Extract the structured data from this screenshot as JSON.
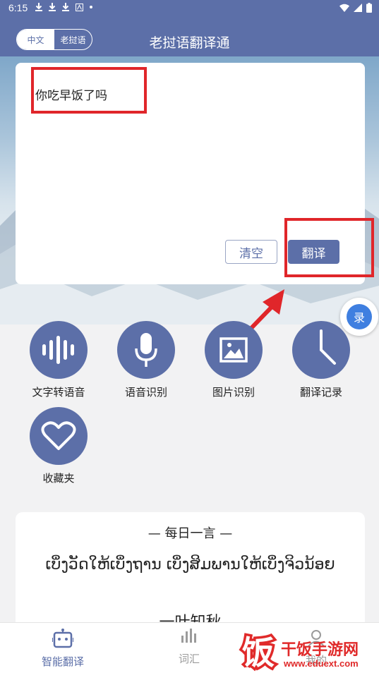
{
  "status_bar": {
    "time": "6:15"
  },
  "header": {
    "title": "老挝语翻译通",
    "lang_options": [
      "中文",
      "老挝语"
    ],
    "selected_lang": "中文"
  },
  "input": {
    "text": "你吃早饭了吗",
    "clear_label": "清空",
    "translate_label": "翻译"
  },
  "floating_badge": {
    "glyph": "录"
  },
  "features": [
    {
      "label": "文字转语音",
      "icon": "soundwave-icon"
    },
    {
      "label": "语音识别",
      "icon": "microphone-icon"
    },
    {
      "label": "图片识别",
      "icon": "image-icon"
    },
    {
      "label": "翻译记录",
      "icon": "clock-icon"
    },
    {
      "label": "收藏夹",
      "icon": "heart-icon"
    }
  ],
  "daily_quote": {
    "heading": "—  每日一言  —",
    "lao": "ເບິ່ງວັດໃຫ້ເບິ່ງຖານ ເບິ່ງສິມພານໃຫ້ເບິ່ງຈິວນ້ອຍ",
    "chinese": "一叶知秋"
  },
  "bottom_nav": [
    {
      "label": "智能翻译",
      "icon": "robot-icon",
      "active": true
    },
    {
      "label": "词汇",
      "icon": "bars-icon",
      "active": false
    },
    {
      "label": "我的",
      "icon": "person-icon",
      "active": false
    }
  ],
  "watermark": {
    "title": "干饭手游网",
    "url": "www.eduext.com",
    "logo_glyph": "饭"
  },
  "colors": {
    "accent": "#5c6fa8",
    "annotation": "#e0262a"
  }
}
